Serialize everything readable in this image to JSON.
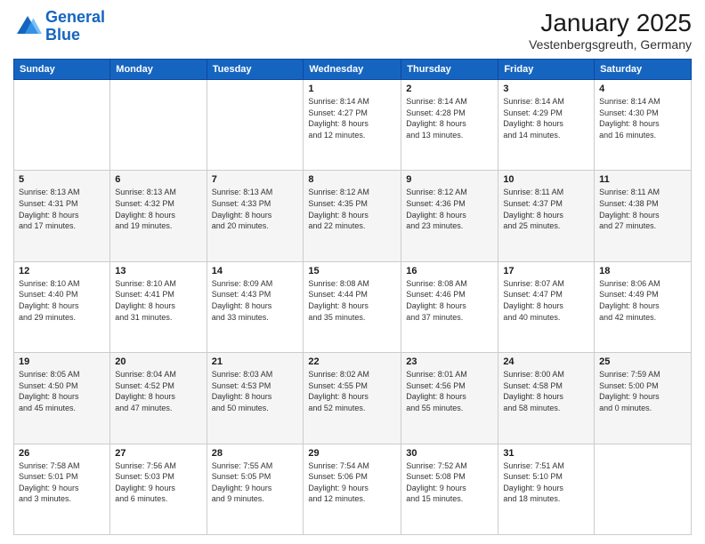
{
  "logo": {
    "line1": "General",
    "line2": "Blue"
  },
  "title": "January 2025",
  "subtitle": "Vestenbergsgreuth, Germany",
  "header_days": [
    "Sunday",
    "Monday",
    "Tuesday",
    "Wednesday",
    "Thursday",
    "Friday",
    "Saturday"
  ],
  "weeks": [
    [
      {
        "day": "",
        "info": ""
      },
      {
        "day": "",
        "info": ""
      },
      {
        "day": "",
        "info": ""
      },
      {
        "day": "1",
        "info": "Sunrise: 8:14 AM\nSunset: 4:27 PM\nDaylight: 8 hours\nand 12 minutes."
      },
      {
        "day": "2",
        "info": "Sunrise: 8:14 AM\nSunset: 4:28 PM\nDaylight: 8 hours\nand 13 minutes."
      },
      {
        "day": "3",
        "info": "Sunrise: 8:14 AM\nSunset: 4:29 PM\nDaylight: 8 hours\nand 14 minutes."
      },
      {
        "day": "4",
        "info": "Sunrise: 8:14 AM\nSunset: 4:30 PM\nDaylight: 8 hours\nand 16 minutes."
      }
    ],
    [
      {
        "day": "5",
        "info": "Sunrise: 8:13 AM\nSunset: 4:31 PM\nDaylight: 8 hours\nand 17 minutes."
      },
      {
        "day": "6",
        "info": "Sunrise: 8:13 AM\nSunset: 4:32 PM\nDaylight: 8 hours\nand 19 minutes."
      },
      {
        "day": "7",
        "info": "Sunrise: 8:13 AM\nSunset: 4:33 PM\nDaylight: 8 hours\nand 20 minutes."
      },
      {
        "day": "8",
        "info": "Sunrise: 8:12 AM\nSunset: 4:35 PM\nDaylight: 8 hours\nand 22 minutes."
      },
      {
        "day": "9",
        "info": "Sunrise: 8:12 AM\nSunset: 4:36 PM\nDaylight: 8 hours\nand 23 minutes."
      },
      {
        "day": "10",
        "info": "Sunrise: 8:11 AM\nSunset: 4:37 PM\nDaylight: 8 hours\nand 25 minutes."
      },
      {
        "day": "11",
        "info": "Sunrise: 8:11 AM\nSunset: 4:38 PM\nDaylight: 8 hours\nand 27 minutes."
      }
    ],
    [
      {
        "day": "12",
        "info": "Sunrise: 8:10 AM\nSunset: 4:40 PM\nDaylight: 8 hours\nand 29 minutes."
      },
      {
        "day": "13",
        "info": "Sunrise: 8:10 AM\nSunset: 4:41 PM\nDaylight: 8 hours\nand 31 minutes."
      },
      {
        "day": "14",
        "info": "Sunrise: 8:09 AM\nSunset: 4:43 PM\nDaylight: 8 hours\nand 33 minutes."
      },
      {
        "day": "15",
        "info": "Sunrise: 8:08 AM\nSunset: 4:44 PM\nDaylight: 8 hours\nand 35 minutes."
      },
      {
        "day": "16",
        "info": "Sunrise: 8:08 AM\nSunset: 4:46 PM\nDaylight: 8 hours\nand 37 minutes."
      },
      {
        "day": "17",
        "info": "Sunrise: 8:07 AM\nSunset: 4:47 PM\nDaylight: 8 hours\nand 40 minutes."
      },
      {
        "day": "18",
        "info": "Sunrise: 8:06 AM\nSunset: 4:49 PM\nDaylight: 8 hours\nand 42 minutes."
      }
    ],
    [
      {
        "day": "19",
        "info": "Sunrise: 8:05 AM\nSunset: 4:50 PM\nDaylight: 8 hours\nand 45 minutes."
      },
      {
        "day": "20",
        "info": "Sunrise: 8:04 AM\nSunset: 4:52 PM\nDaylight: 8 hours\nand 47 minutes."
      },
      {
        "day": "21",
        "info": "Sunrise: 8:03 AM\nSunset: 4:53 PM\nDaylight: 8 hours\nand 50 minutes."
      },
      {
        "day": "22",
        "info": "Sunrise: 8:02 AM\nSunset: 4:55 PM\nDaylight: 8 hours\nand 52 minutes."
      },
      {
        "day": "23",
        "info": "Sunrise: 8:01 AM\nSunset: 4:56 PM\nDaylight: 8 hours\nand 55 minutes."
      },
      {
        "day": "24",
        "info": "Sunrise: 8:00 AM\nSunset: 4:58 PM\nDaylight: 8 hours\nand 58 minutes."
      },
      {
        "day": "25",
        "info": "Sunrise: 7:59 AM\nSunset: 5:00 PM\nDaylight: 9 hours\nand 0 minutes."
      }
    ],
    [
      {
        "day": "26",
        "info": "Sunrise: 7:58 AM\nSunset: 5:01 PM\nDaylight: 9 hours\nand 3 minutes."
      },
      {
        "day": "27",
        "info": "Sunrise: 7:56 AM\nSunset: 5:03 PM\nDaylight: 9 hours\nand 6 minutes."
      },
      {
        "day": "28",
        "info": "Sunrise: 7:55 AM\nSunset: 5:05 PM\nDaylight: 9 hours\nand 9 minutes."
      },
      {
        "day": "29",
        "info": "Sunrise: 7:54 AM\nSunset: 5:06 PM\nDaylight: 9 hours\nand 12 minutes."
      },
      {
        "day": "30",
        "info": "Sunrise: 7:52 AM\nSunset: 5:08 PM\nDaylight: 9 hours\nand 15 minutes."
      },
      {
        "day": "31",
        "info": "Sunrise: 7:51 AM\nSunset: 5:10 PM\nDaylight: 9 hours\nand 18 minutes."
      },
      {
        "day": "",
        "info": ""
      }
    ]
  ]
}
